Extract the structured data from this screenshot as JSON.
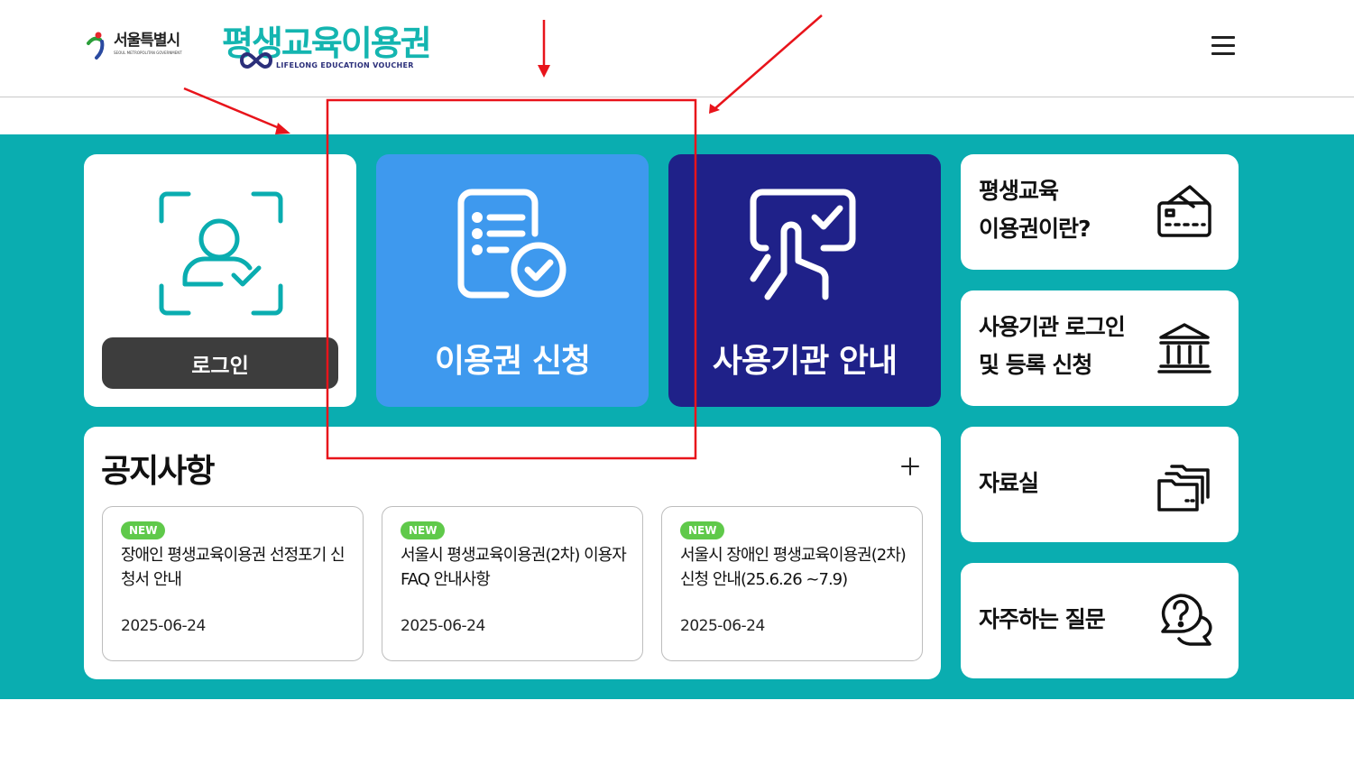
{
  "header": {
    "seoul_logo_ko": "서울특별시",
    "seoul_logo_en": "SEOUL METROPOLITAN GOVERNMENT",
    "brand_ko": "평생교육이용권",
    "brand_en": "LIFELONG EDUCATION VOUCHER",
    "menu_icon": "hamburger-menu-icon"
  },
  "login": {
    "button_label": "로그인",
    "icon": "face-id-user-check-icon"
  },
  "apply": {
    "label": "이용권 신청",
    "icon": "document-checklist-icon"
  },
  "institution": {
    "label": "사용기관 안내",
    "icon": "touch-screen-check-icon"
  },
  "side_links": [
    {
      "line1": "평생교육",
      "line2": "이용권이란?",
      "icon": "card-icon"
    },
    {
      "line1": "사용기관 로그인",
      "line2": "및 등록 신청",
      "icon": "bank-icon"
    },
    {
      "line1": "자료실",
      "icon": "folders-icon"
    },
    {
      "line1": "자주하는 질문",
      "icon": "question-chat-icon"
    }
  ],
  "notice": {
    "title": "공지사항",
    "items": [
      {
        "badge": "NEW",
        "title": "장애인 평생교육이용권 선정포기 신청서 안내",
        "date": "2025-06-24"
      },
      {
        "badge": "NEW",
        "title": "서울시 평생교육이용권(2차) 이용자 FAQ 안내사항",
        "date": "2025-06-24"
      },
      {
        "badge": "NEW",
        "title": "서울시 장애인 평생교육이용권(2차) 신청 안내(25.6.26 ~7.9)",
        "date": "2025-06-24"
      }
    ]
  },
  "colors": {
    "teal": "#0aadb0",
    "apply_blue": "#3e99ee",
    "institution_navy": "#1f2189",
    "badge_green": "#5fc94a",
    "annotation_red": "#e8141b"
  }
}
